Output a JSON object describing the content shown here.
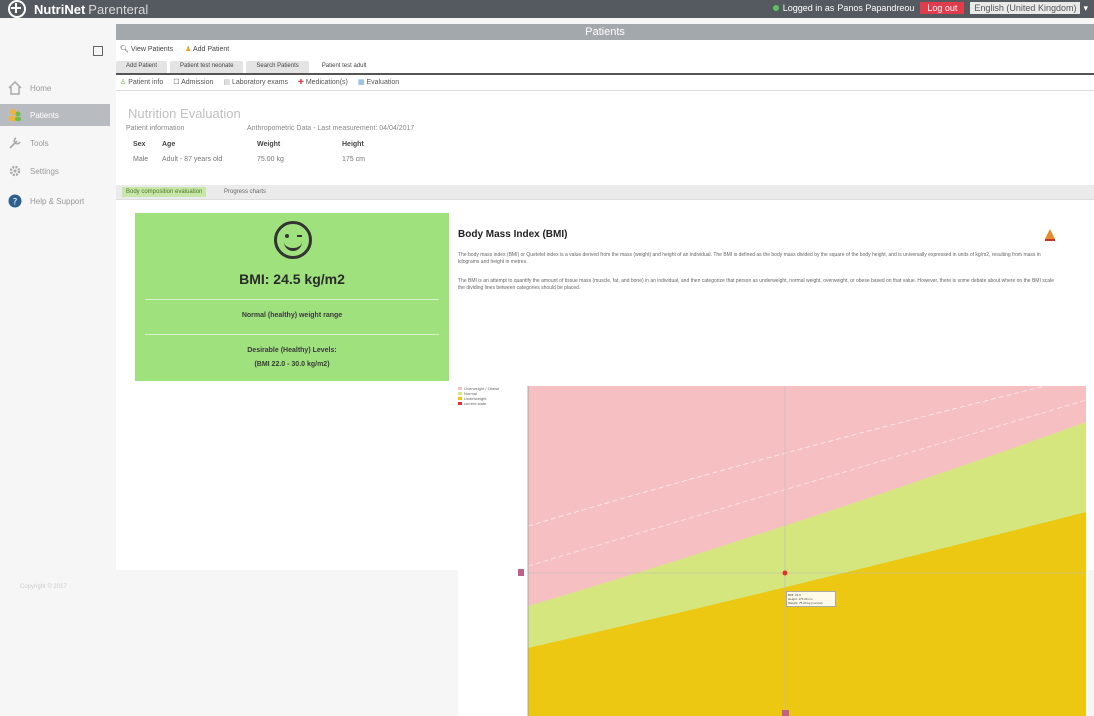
{
  "app": {
    "name": "NutriNet",
    "suffix": "Parenteral"
  },
  "header": {
    "logged_in_label": "Logged in as",
    "user": "Panos Papandreou",
    "logout": "Log out",
    "language": "English (United Kingdom)"
  },
  "page_title": "Patients",
  "sidebar": {
    "items": [
      {
        "label": "Home",
        "icon": "home-icon"
      },
      {
        "label": "Patients",
        "icon": "patients-icon"
      },
      {
        "label": "Tools",
        "icon": "tools-icon"
      },
      {
        "label": "Settings",
        "icon": "gear-icon"
      },
      {
        "label": "Help & Support",
        "icon": "help-icon"
      }
    ]
  },
  "actions": {
    "view": "View Patients",
    "add": "Add Patient"
  },
  "tabs": [
    "Add Patient",
    "Patient test neonate",
    "Search Patients",
    "Patient test adult"
  ],
  "subtabs": [
    "Patient info",
    "Admission",
    "Laboratory exams",
    "Medication(s)",
    "Evaluation"
  ],
  "evaluation": {
    "title": "Nutrition Evaluation",
    "patient_info_label": "Patient information",
    "anthro_label": "Anthropometric Data - Last measurement: 04/04/2017",
    "headers": [
      "Sex",
      "Age",
      "Weight",
      "Height"
    ],
    "values": [
      "Male",
      "Adult - 87 years old",
      "75.00 kg",
      "175 cm"
    ]
  },
  "content_tabs": [
    "Body composition evaluation",
    "Progress charts"
  ],
  "bmi_card": {
    "value": "BMI: 24.5 kg/m2",
    "range": "Normal (healthy) weight range",
    "desirable_title": "Desirable (Healthy) Levels:",
    "desirable_range": "(BMI 22.0 - 30.0 kg/m2)",
    "color": "#9fe27d"
  },
  "info": {
    "title": "Body Mass Index (BMI)",
    "para1": "The body mass index (BMI) or Quetelet index is a value derived from the mass (weight) and height of an individual. The BMI is defined as the body mass divided by the square of the body height, and is universally expressed in units of kg/m2, resulting from mass in kilograms and height in metres.",
    "para2": "The BMI is an attempt to quantify the amount of tissue mass (muscle, fat, and bone) in an individual, and then categorize that person as underweight, normal weight, overweight, or obese based on that value. However, there is some debate about where on the BMI scale the dividing lines between categories should be placed."
  },
  "chart": {
    "legend": [
      "Overweight / Obese",
      "Normal",
      "Underweight",
      "current state"
    ],
    "colors": {
      "overweight": "#f6c0c3",
      "normal": "#d5e67e",
      "underweight": "#ecc812",
      "marker": "#e03030"
    },
    "tooltip": [
      "BMI: 24.5",
      "Height: 175.00 cm",
      "Weight: 75.00 kg (normal)"
    ]
  },
  "footer": "Copyright © 2017"
}
